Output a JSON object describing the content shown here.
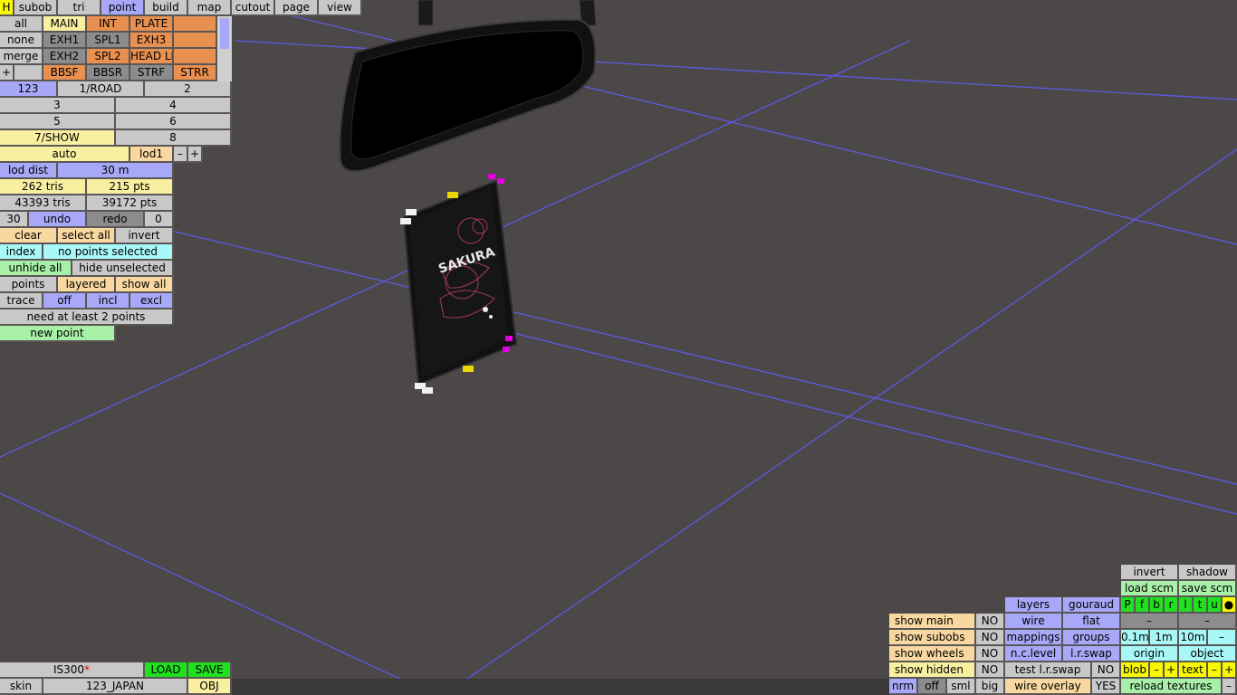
{
  "topbar": {
    "h": "H",
    "tabs": [
      "subob",
      "tri",
      "point",
      "build",
      "map",
      "cutout",
      "page",
      "view"
    ]
  },
  "layer_grid": {
    "row1": [
      "all",
      "MAIN",
      "INT",
      "PLATE",
      ""
    ],
    "row2": [
      "none",
      "EXH1",
      "SPL1",
      "EXH3",
      ""
    ],
    "row3": [
      "merge",
      "EXH2",
      "SPL2",
      "HEAD LI",
      ""
    ],
    "row4": [
      "+",
      "",
      "BBSF",
      "BBSR",
      "STRF",
      "STRR"
    ]
  },
  "lod_buttons": {
    "b123": "123",
    "road": "1/ROAD",
    "b2": "2",
    "b3": "3",
    "b4": "4",
    "b5": "5",
    "b6": "6",
    "show": "7/SHOW",
    "b8": "8"
  },
  "lod": {
    "auto": "auto",
    "lod1": "lod1",
    "minus": "–",
    "plus": "+",
    "lod_dist_label": "lod dist",
    "lod_dist_value": "30 m",
    "tris": "262 tris",
    "pts": "215 pts",
    "total_tris": "43393 tris",
    "total_pts": "39172 pts"
  },
  "undo_row": {
    "count": "30",
    "undo": "undo",
    "redo": "redo",
    "redo_count": "0"
  },
  "selection": {
    "clear": "clear",
    "select_all": "select all",
    "invert": "invert",
    "index": "index",
    "status": "no points selected",
    "unhide_all": "unhide all",
    "hide_unselected": "hide unselected",
    "points": "points",
    "layered": "layered",
    "show_all": "show all",
    "trace": "trace",
    "off": "off",
    "incl": "incl",
    "excl": "excl",
    "need_points": "need at least 2 points",
    "new_point": "new point"
  },
  "file": {
    "name": "IS300",
    "modified": "*",
    "load": "LOAD",
    "save": "SAVE",
    "skin": "skin",
    "skin_name": "123_JAPAN",
    "obj": "OBJ"
  },
  "right_panel": {
    "invert": "invert",
    "shadow": "shadow",
    "load_scm": "load scm",
    "save_scm": "save scm",
    "layers": "layers",
    "gouraud": "gouraud",
    "flags": [
      "P",
      "f",
      "b",
      "r",
      "l",
      "t",
      "u",
      "●"
    ],
    "wire": "wire",
    "flat": "flat",
    "dash1": "–",
    "dash2": "–",
    "mappings": "mappings",
    "groups": "groups",
    "s01": "0.1m",
    "s1": "1m",
    "s10": "10m",
    "sdash": "–",
    "nclevel": "n.c.level",
    "lrswap": "l.r.swap",
    "origin": "origin",
    "object": "object",
    "test_lrswap": "test l.r.swap",
    "test_no": "NO",
    "blob": "blob",
    "blob_minus": "–",
    "blob_plus": "+",
    "text": "text",
    "text_minus": "–",
    "text_plus": "+",
    "wire_overlay": "wire overlay",
    "wire_yes": "YES",
    "reload_textures": "reload textures",
    "reload_minus": "–",
    "nrm": "nrm",
    "off": "off",
    "sml": "sml",
    "big": "big"
  },
  "show_panel": [
    {
      "label": "show main",
      "value": "NO"
    },
    {
      "label": "show subobs",
      "value": "NO"
    },
    {
      "label": "show wheels",
      "value": "NO"
    },
    {
      "label": "show hidden",
      "value": "NO"
    }
  ],
  "plate_text": "SAKURA",
  "colors": {
    "background": "#4c4848",
    "grid": "#5c5cf0",
    "selected_tab": "#a8a8f8",
    "orange": "#e89050"
  }
}
